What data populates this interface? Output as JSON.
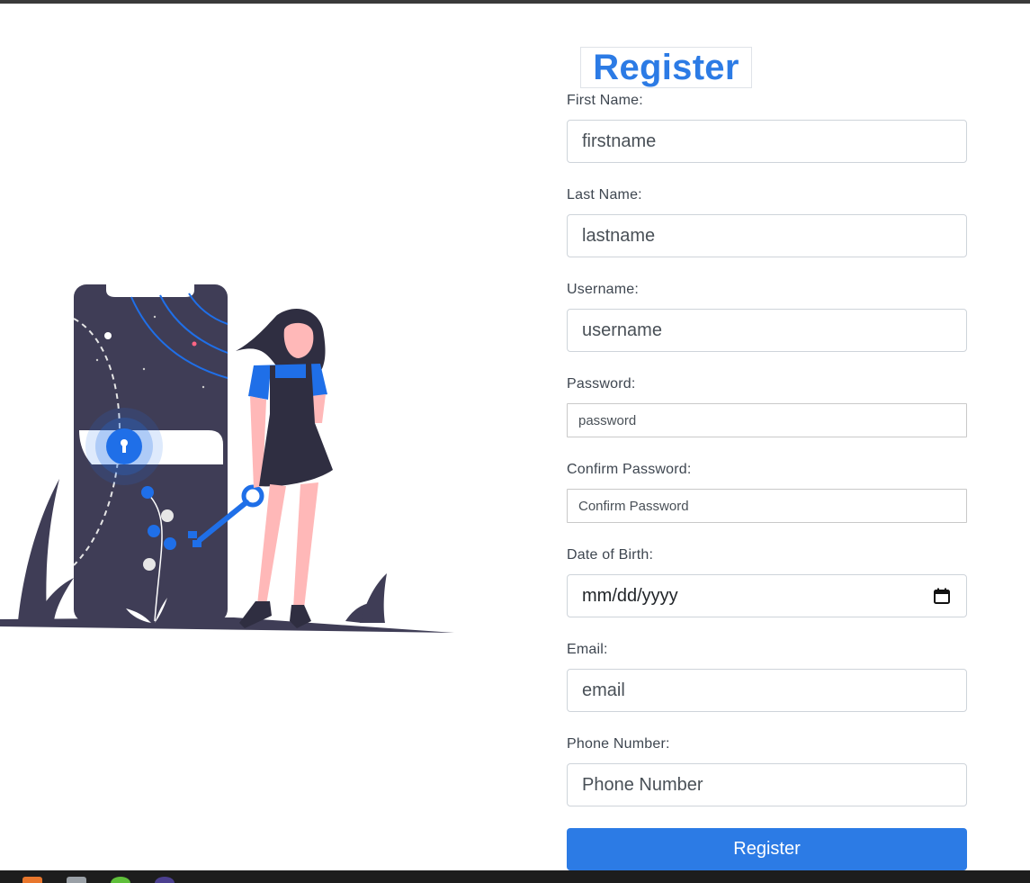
{
  "title": "Register",
  "fields": [
    {
      "label": "First Name:",
      "placeholder": "firstname"
    },
    {
      "label": "Last Name:",
      "placeholder": "lastname"
    },
    {
      "label": "Username:",
      "placeholder": "username"
    },
    {
      "label": "Password:",
      "placeholder": "password"
    },
    {
      "label": "Confirm Password:",
      "placeholder": "Confirm Password"
    },
    {
      "label": "Date of Birth:",
      "placeholder": "mm/dd/yyyy"
    },
    {
      "label": "Email:",
      "placeholder": "email"
    },
    {
      "label": "Phone Number:",
      "placeholder": "Phone Number"
    }
  ],
  "submit_label": "Register",
  "colors": {
    "accent": "#2c7be5",
    "illustration_dark": "#3f3d56",
    "illustration_blue": "#1f6fe8",
    "skin": "#ffb8b8"
  },
  "icons": {
    "date": "calendar-icon",
    "lock": "keyhole-icon"
  }
}
